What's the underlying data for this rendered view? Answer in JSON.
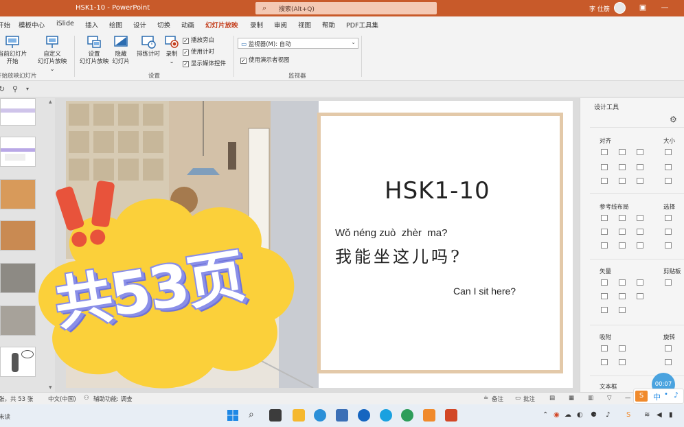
{
  "window": {
    "doc_title": "HSK1-10 - PowerPoint",
    "search_placeholder": "搜索(Alt+Q)",
    "user_name": "李 仕筋"
  },
  "ribbon_tabs": [
    "开始",
    "模板中心",
    "iSlide",
    "插入",
    "绘图",
    "设计",
    "切换",
    "动画",
    "幻灯片放映",
    "录制",
    "审阅",
    "视图",
    "帮助",
    "PDF工具集"
  ],
  "active_tab": "幻灯片放映",
  "ribbon": {
    "from_current_label": "当前幻灯片开始",
    "from_current_line1": "当前幻灯片",
    "from_current_line2": "开始",
    "custom_show_line1": "自定义",
    "custom_show_line2": "幻灯片放映",
    "group_start": "开始放映幻灯片",
    "setup_line1": "设置",
    "setup_line2": "幻灯片放映",
    "hide_line1": "隐藏",
    "hide_line2": "幻灯片",
    "rehearse_label": "排练计时",
    "record_label": "录制",
    "chk_narration": "播放旁白",
    "chk_timings": "使用计时",
    "chk_media": "显示媒体控件",
    "group_setup": "设置",
    "monitor_label": "监视器(M):",
    "monitor_value": "自动",
    "chk_presenter": "使用演示者视图",
    "group_monitor": "监视器"
  },
  "slide": {
    "title": "HSK1-10",
    "pinyin": "Wǒ néng zuò  zhèr  ma?",
    "hanzi": "我能坐这儿吗?",
    "english": "Can I sit here?"
  },
  "overlay": {
    "text": "共53页"
  },
  "design_pane": {
    "title": "设计工具",
    "align": "对齐",
    "size": "大小",
    "guides": "参考线布局",
    "select": "选择",
    "vector": "矢量",
    "clipboard": "剪贴板",
    "adsorb": "吸附",
    "rotate": "旋转",
    "textbox": "文本框",
    "timer": "00:07"
  },
  "status": {
    "slide_count": "张，共 53 张",
    "language": "中文(中国)",
    "accessibility": "辅助功能: 调查",
    "notes": "备注",
    "comments": "批注"
  },
  "taskbar": {
    "left_text": "未读",
    "ime_label": "中"
  },
  "colors": {
    "titlebar": "#c85a2a",
    "accent": "#c43e1c",
    "frame": "#e3c9a9",
    "sticker_yellow": "#fbd03a",
    "sticker_red": "#e8533b",
    "sticker_purple": "#8a8fe8",
    "timer_blue": "#4aa3df"
  }
}
